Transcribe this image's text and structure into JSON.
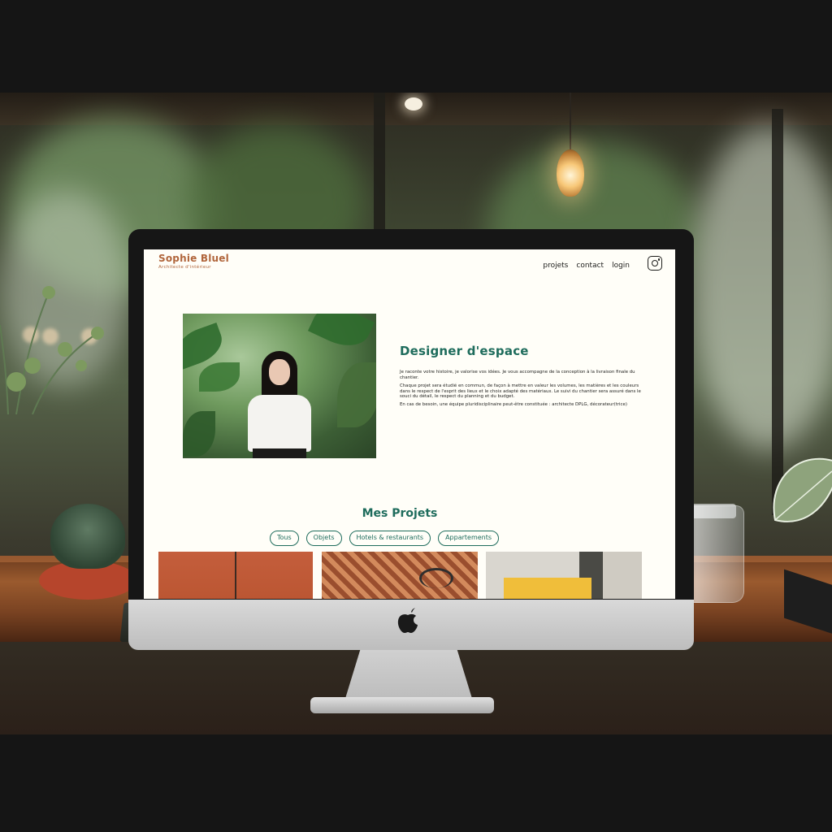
{
  "site": {
    "logo": "Sophie Bluel",
    "logo_sub": "Architecte d'intérieur",
    "nav": [
      "projets",
      "contact",
      "login"
    ],
    "instagram_icon": "instagram-icon"
  },
  "about": {
    "title": "Designer d'espace",
    "paragraphs": [
      "Je raconte votre histoire, je valorise vos idées. Je vous accompagne de la conception à la livraison finale du chantier.",
      "Chaque projet sera étudié en commun, de façon à mettre en valeur les volumes, les matières et les couleurs dans le respect de l'esprit des lieux et le choix adapté des matériaux. Le suivi du chantier sera assuré dans le souci du détail, le respect du planning et du budget.",
      "En cas de besoin, une équipe pluridisciplinaire peut-être constituée : architecte DPLG, décorateur(trice)"
    ]
  },
  "projects": {
    "title": "Mes Projets",
    "filters": [
      "Tous",
      "Objets",
      "Hotels & restaurants",
      "Appartements"
    ]
  },
  "colors": {
    "accent": "#1e6c5c",
    "logo": "#b1663c",
    "page_bg": "#fffef8"
  }
}
